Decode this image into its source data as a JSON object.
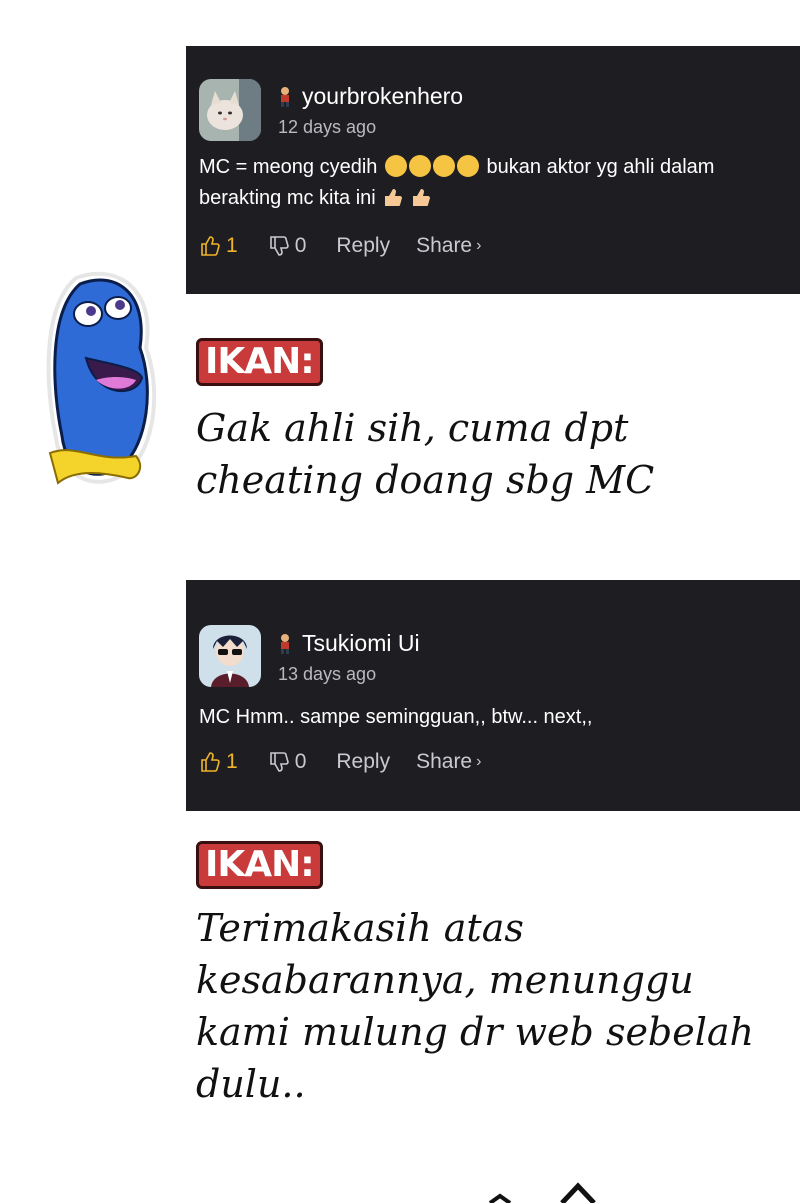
{
  "comments": [
    {
      "username": "yourbrokenhero",
      "time": "12 days ago",
      "text_part1": "MC = meong cyedih",
      "text_part2": "bukan aktor yg ahli dalam berakting mc kita ini",
      "likes": "1",
      "dislikes": "0",
      "reply_label": "Reply",
      "share_label": "Share",
      "share_chevron": "›"
    },
    {
      "username": "Tsukiomi Ui",
      "time": "13 days ago",
      "text": "MC Hmm.. sampe semingguan,, btw... next,,",
      "likes": "1",
      "dislikes": "0",
      "reply_label": "Reply",
      "share_label": "Share",
      "share_chevron": "›"
    }
  ],
  "responses": [
    {
      "speaker": "IKAN:",
      "text": "Gak ahli sih, cuma dpt cheating doang sbg MC"
    },
    {
      "speaker": "IKAN:",
      "text": "Terimakasih atas kesabarannya, menunggu kami mulung dr web sebelah dulu.."
    }
  ],
  "colors": {
    "card_bg": "#1e1e22",
    "like_accent": "#f0b429",
    "speaker_bg": "#c93a3a"
  }
}
